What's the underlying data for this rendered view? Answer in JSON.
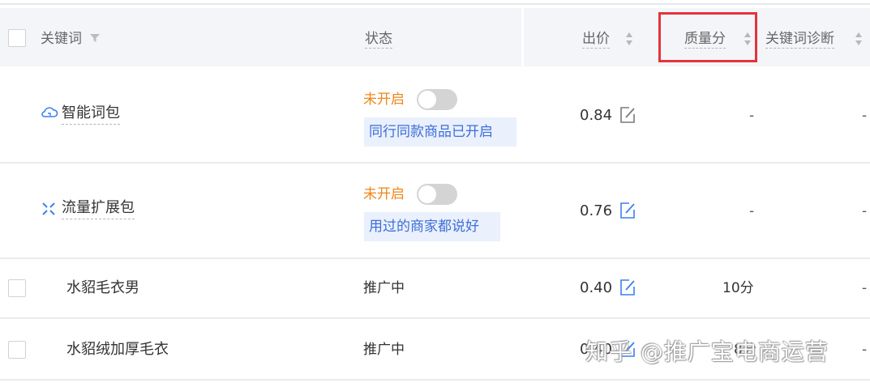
{
  "header": {
    "keyword": "关键词",
    "status": "状态",
    "bid": "出价",
    "quality": "质量分",
    "diagnosis": "关键词诊断"
  },
  "rows": [
    {
      "keyword": "智能词包",
      "icon": "cloud-icon",
      "status": "未开启",
      "tag": "同行同款商品已开启",
      "bid": "0.84",
      "quality": "-",
      "diagnosis": "-"
    },
    {
      "keyword": "流量扩展包",
      "icon": "expand-icon",
      "status": "未开启",
      "tag": "用过的商家都说好",
      "bid": "0.76",
      "quality": "-",
      "diagnosis": "-"
    },
    {
      "keyword": "水貂毛衣男",
      "status": "推广中",
      "bid": "0.40",
      "quality": "10分",
      "diagnosis": "-"
    },
    {
      "keyword": "水貂绒加厚毛衣",
      "status": "推广中",
      "bid": "0.40",
      "quality": "8分",
      "diagnosis": "-"
    }
  ],
  "watermark": "知乎 @推广宝电商运营",
  "colors": {
    "highlight": "#e4333c",
    "status_off": "#f08519",
    "tag_text": "#3d6fd8",
    "tag_bg": "#eaf0fc",
    "icon": "#3d7ff0"
  }
}
